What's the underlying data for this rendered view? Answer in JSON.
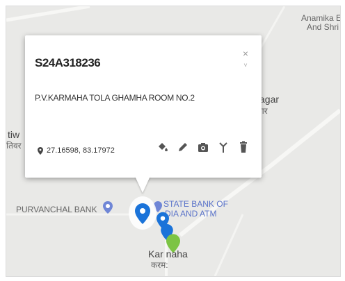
{
  "popup": {
    "title": "S24A318236",
    "address": "P.V.KARMAHA TOLA GHAMHA ROOM NO.2",
    "coordinates": "27.16598, 83.17972",
    "close_glyph": "×",
    "scroll_glyph": "˅"
  },
  "map_labels": {
    "anamika_line1": "Anamika E",
    "anamika_line2": "And Shri",
    "nagar_en": "agar",
    "nagar_hi": "गर",
    "left_en": "tiw",
    "left_hi": "तिवर",
    "purvanchal_bank": "PURVANCHAL BANK",
    "sbi_line1": "STATE BANK OF",
    "sbi_line2": "DIA AND ATM",
    "karmaha_en": "Kar   naha",
    "karmaha_hi": "करम:"
  },
  "colors": {
    "marker_blue": "#1a73d9",
    "marker_green": "#7cc444",
    "poi_blue": "#5a73c9"
  },
  "icons": [
    "location-pin-icon",
    "paint-bucket-icon",
    "pencil-icon",
    "camera-icon",
    "antenna-icon",
    "trash-icon",
    "close-icon"
  ]
}
